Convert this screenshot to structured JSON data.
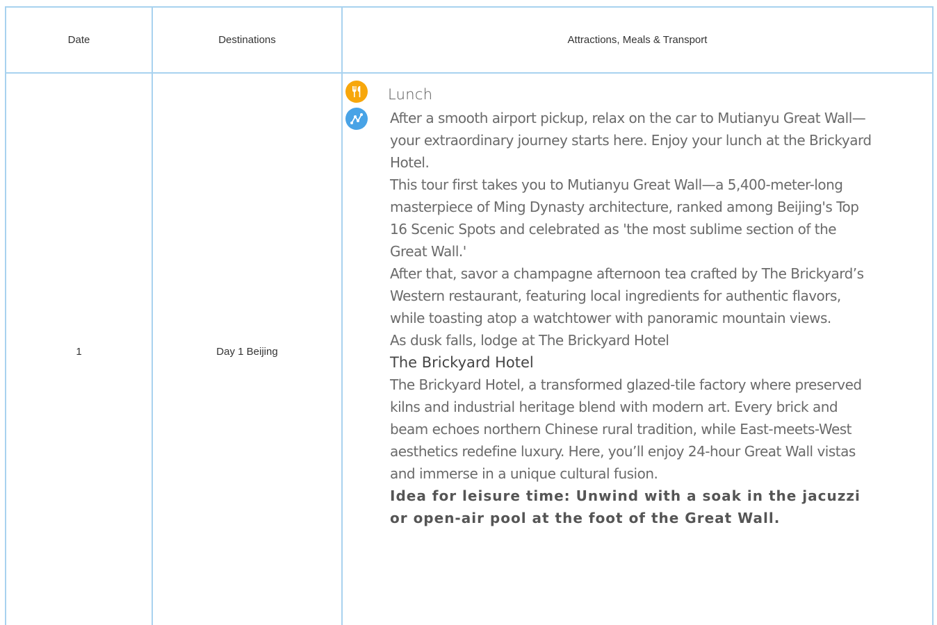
{
  "table": {
    "headers": {
      "date": "Date",
      "destinations": "Destinations",
      "details": "Attractions, Meals & Transport"
    },
    "row": {
      "date": "1",
      "destination": "Day 1 Beijing",
      "meal_icon": "fork-knife-icon",
      "route_icon": "route-icon",
      "meal_label": "Lunch",
      "paragraphs": [
        "After a smooth airport pickup, relax on the car to Mutianyu Great Wall—your extraordinary journey starts here. Enjoy your lunch at the Brickyard Hotel.",
        "This tour first takes you to Mutianyu Great Wall—a 5,400-meter-long masterpiece of Ming Dynasty architecture, ranked among Beijing's Top 16 Scenic Spots and celebrated as 'the most sublime section of the Great Wall.'",
        "After that, savor a champagne afternoon tea crafted by The Brickyard’s Western restaurant, featuring local ingredients for authentic flavors, while toasting atop a watchtower with panoramic mountain views.",
        "As dusk falls, lodge at The Brickyard Hotel"
      ],
      "hotel_name": "The Brickyard Hotel",
      "hotel_description": "The Brickyard Hotel, a transformed glazed-tile factory where preserved kilns and industrial heritage blend with modern art. Every brick and beam echoes northern Chinese rural tradition, while East-meets-West aesthetics redefine luxury. Here, you’ll enjoy 24-hour Great Wall vistas and immerse in a unique cultural fusion.",
      "leisure_tip": "Idea for leisure time: Unwind with a soak in the jacuzzi or open-air pool at the foot of the Great Wall."
    }
  },
  "colors": {
    "border": "#a8d2ef",
    "meal_icon_bg": "#f7a70c",
    "route_icon_bg": "#48a3e6"
  }
}
